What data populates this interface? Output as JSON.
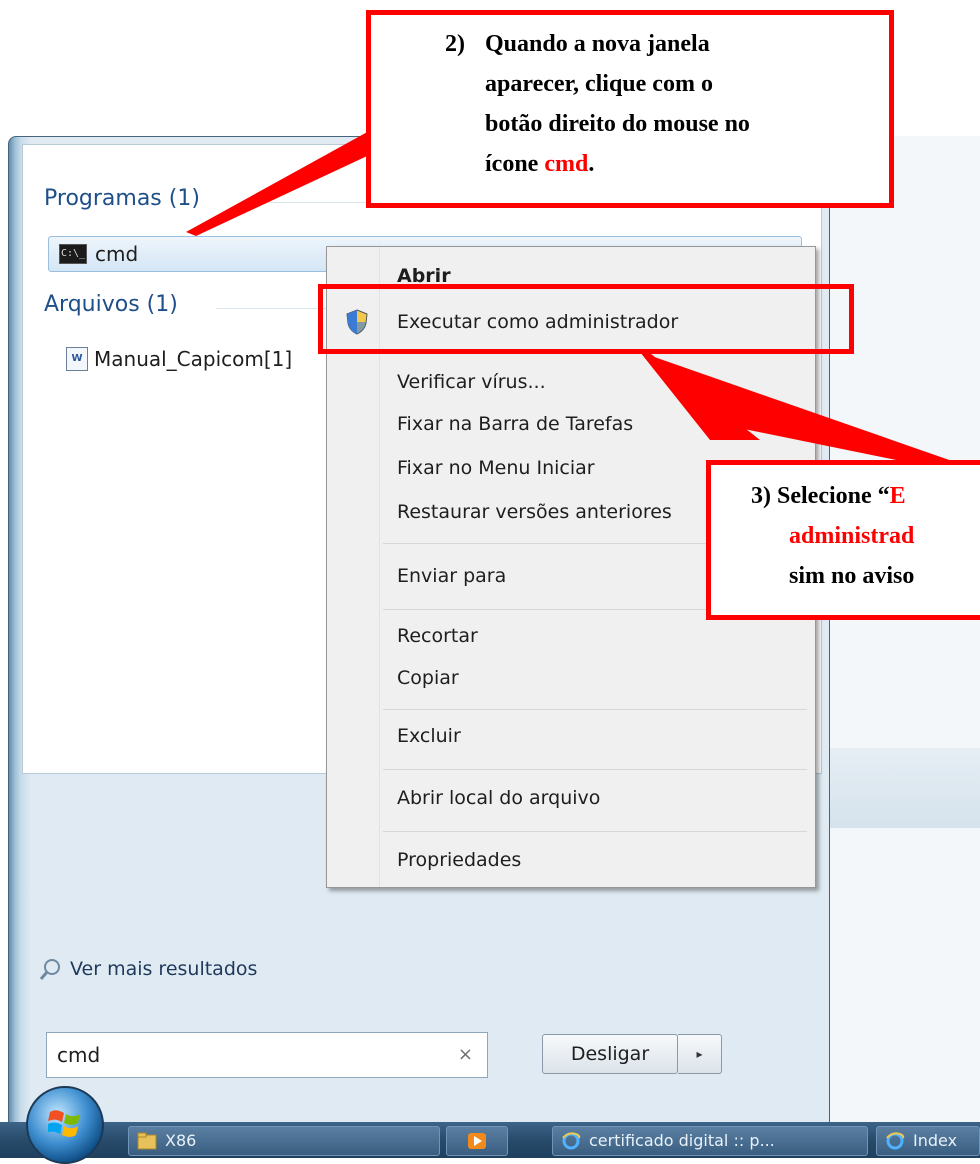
{
  "start_menu": {
    "programs_label": "Programas (1)",
    "programs_item": "cmd",
    "files_label": "Arquivos (1)",
    "files_item": "Manual_Capicom[1]",
    "more_results": "Ver mais resultados",
    "search_value": "cmd",
    "search_clear": "×",
    "shutdown_label": "Desligar",
    "shutdown_arrow": "▸"
  },
  "context_menu": {
    "items": [
      "Abrir",
      "Executar como administrador",
      "Verificar vírus...",
      "Fixar na Barra de Tarefas",
      "Fixar no Menu Iniciar",
      "Restaurar versões anteriores",
      "Enviar para",
      "Recortar",
      "Copiar",
      "Excluir",
      "Abrir local do arquivo",
      "Propriedades"
    ]
  },
  "taskbar": {
    "items": [
      "X86",
      "",
      "certificado digital :: p...",
      "Index"
    ]
  },
  "callouts": {
    "step2": {
      "num": "2)",
      "line1": "Quando a nova janela",
      "line2": "aparecer, clique com o",
      "line3": "botão direito do mouse no",
      "line4_pre": "ícone ",
      "line4_red": "cmd",
      "line4_post": "."
    },
    "step3": {
      "num": "3)",
      "line1_pre": "Selecione “",
      "line1_red": "E",
      "line2_red": "administrad",
      "line3": "sim no aviso"
    }
  },
  "colors": {
    "annotation": "#ff0000",
    "menu_bg": "#f0f0f0",
    "taskbar": "#2a4d6d"
  }
}
